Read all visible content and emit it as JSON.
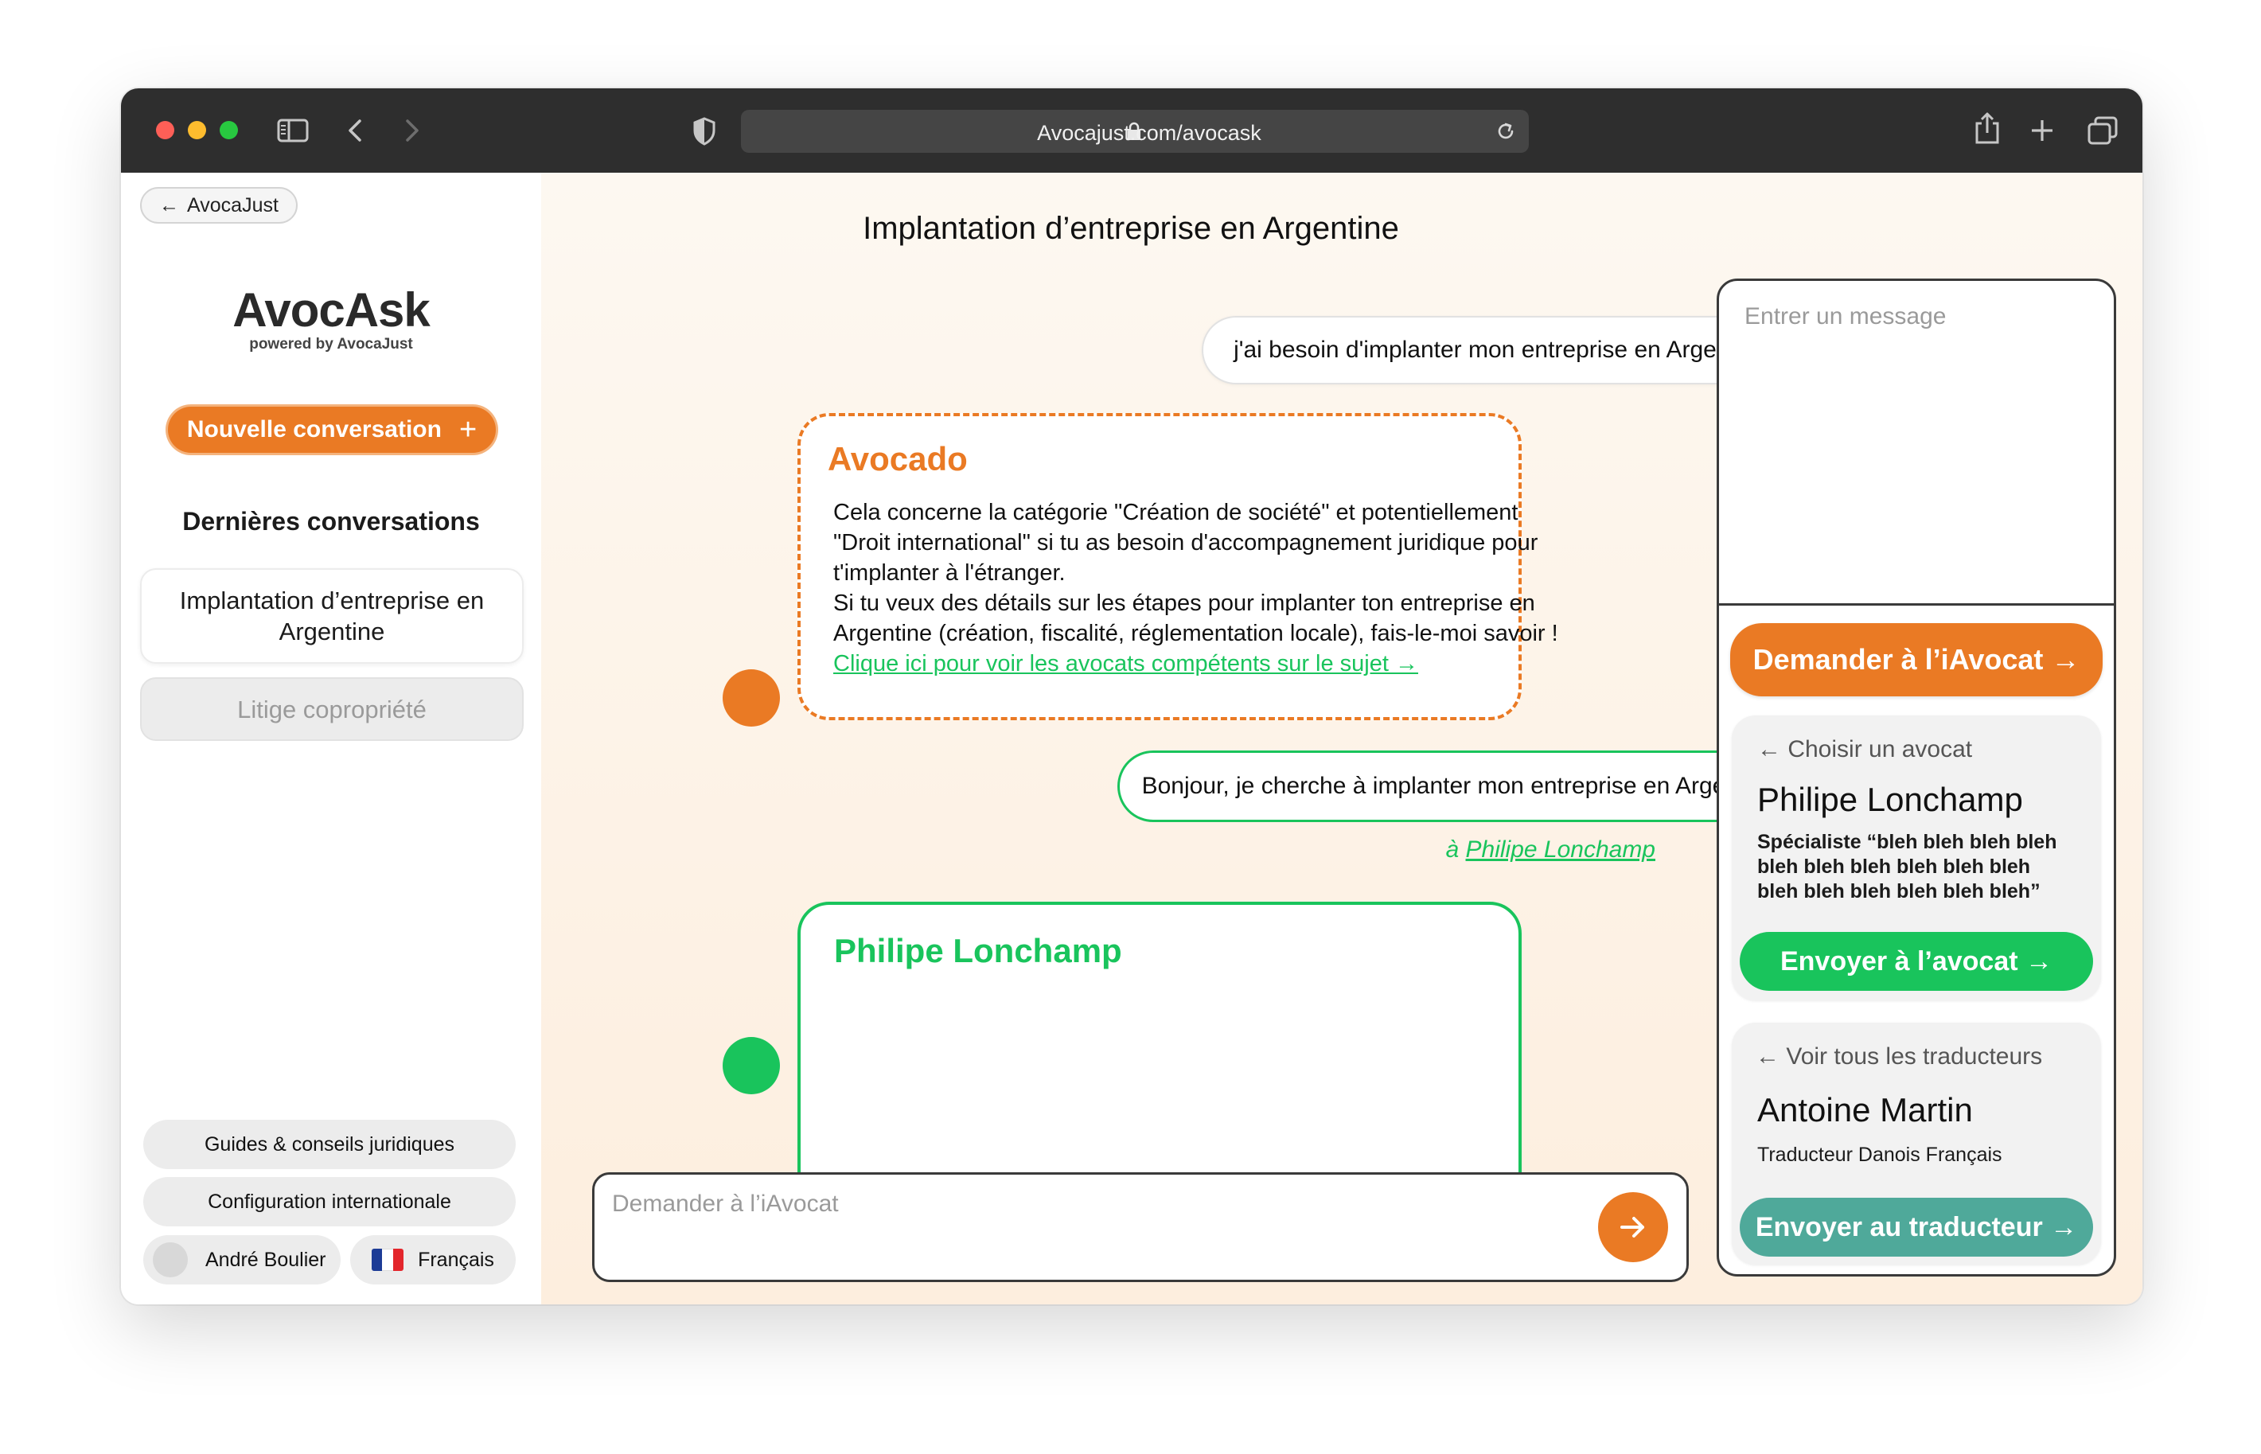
{
  "browser": {
    "url": "Avocajust.com/avocask"
  },
  "sidebar": {
    "back_label": "AvocaJust",
    "logo": "AvocAsk",
    "logo_sub": "powered by AvocaJust",
    "new_conversation": "Nouvelle conversation",
    "recent_title": "Dernières conversations",
    "conversations": [
      {
        "label": "Implantation d’entreprise en Argentine",
        "active": true
      },
      {
        "label": "Litige copropriété",
        "active": false
      }
    ],
    "bottom": {
      "guides": "Guides & conseils juridiques",
      "config": "Configuration internationale",
      "user": "André Boulier",
      "language": "Français"
    }
  },
  "chat": {
    "title": "Implantation d’entreprise en Argentine",
    "messages": {
      "user1": "j'ai besoin d'implanter mon entreprise en Argentine",
      "ai_name": "Avocado",
      "ai_lines": [
        "Cela concerne la catégorie \"Création de société\" et potentiellement",
        "\"Droit international\" si tu as besoin d'accompagnement juridique pour",
        "t'implanter à l'étranger.",
        "Si tu veux des détails sur les étapes pour implanter ton entreprise en",
        "Argentine (création, fiscalité, réglementation locale), fais-le-moi savoir !"
      ],
      "ai_link": "Clique ici pour voir les avocats compétents sur le sujet →",
      "user2": "Bonjour, je cherche à implanter mon entreprise en Argentine",
      "user2_to_prefix": "à",
      "user2_to_name": "Philipe Lonchamp",
      "lawyer_name": "Philipe Lonchamp"
    },
    "input_placeholder": "Demander à l’iAvocat"
  },
  "panel": {
    "message_placeholder": "Entrer un message",
    "ask_button": "Demander à l’iAvocat →",
    "lawyer_card": {
      "back": "← Choisir un avocat",
      "name": "Philipe Lonchamp",
      "desc_lines": [
        "Spécialiste “bleh bleh bleh bleh",
        "bleh bleh bleh bleh bleh bleh",
        "bleh bleh bleh bleh bleh bleh”"
      ],
      "send": "Envoyer à l’avocat →"
    },
    "translator_card": {
      "back": "← Voir tous les traducteurs",
      "name": "Antoine Martin",
      "desc": "Traducteur Danois Français",
      "send": "Envoyer au traducteur →"
    }
  },
  "colors": {
    "orange": "#ea7a24",
    "green": "#19c45c",
    "teal": "#4fa99a"
  }
}
